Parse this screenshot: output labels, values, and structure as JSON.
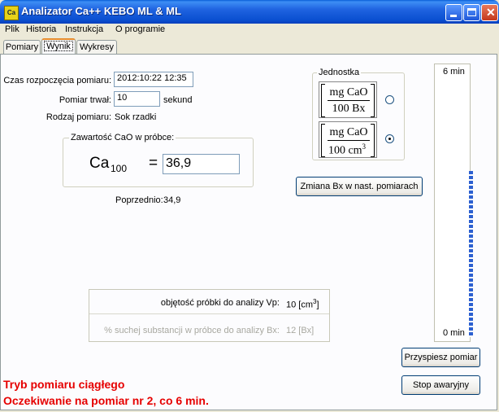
{
  "window": {
    "title": "Analizator Ca++ KEBO ML & ML",
    "icon_text": "Ca"
  },
  "menu": [
    "Plik",
    "Historia",
    "Instrukcja",
    "O programie"
  ],
  "tabs": [
    {
      "label": "Pomiary",
      "active": false
    },
    {
      "label": "Wynik",
      "active": true
    },
    {
      "label": "Wykresy",
      "active": false
    }
  ],
  "info": {
    "start_label": "Czas rozpoczęcia pomiaru:",
    "start_value": "2012:10:22  12:35",
    "duration_label": "Pomiar trwał:",
    "duration_value": "10",
    "duration_unit": "sekund",
    "type_label": "Rodzaj pomiaru:",
    "type_value": "Sok rzadki"
  },
  "result": {
    "group_title": "Zawartość CaO w próbce:",
    "symbol": "Ca",
    "subscript": "100",
    "equals": "=",
    "value": "36,9",
    "previous_label": "Poprzednio:",
    "previous_value": "34,9"
  },
  "unit": {
    "group_title": "Jednostka",
    "options": [
      {
        "numerator": "mg CaO",
        "denominator": "100 Bx",
        "selected": false
      },
      {
        "numerator": "mg CaO",
        "denominator": "100 cm",
        "sup": "3",
        "selected": true
      }
    ]
  },
  "change_bx_button": "Zmiana Bx w nast. pomiarach",
  "sample": {
    "volume_label": "objętość próbki do analizy Vp:",
    "volume_value": "10 [cm",
    "volume_sup": "3",
    "volume_close": "]",
    "dry_label": "% suchej substancji w próbce do analizy Bx:",
    "dry_value": "12 [Bx]"
  },
  "timer": {
    "top_label": "6 min",
    "bottom_label": "0 min",
    "progress": 0.6
  },
  "buttons": {
    "speed_up": "Przyspiesz pomiar",
    "emergency_stop": "Stop awaryjny"
  },
  "status": {
    "line1": "Tryb pomiaru ciągłego",
    "line2": "Oczekiwanie na pomiar nr 2, co 6 min."
  },
  "colors": {
    "titlebar": "#0a4fd0",
    "status_text": "#e60000",
    "progress": "#2c60d0"
  }
}
